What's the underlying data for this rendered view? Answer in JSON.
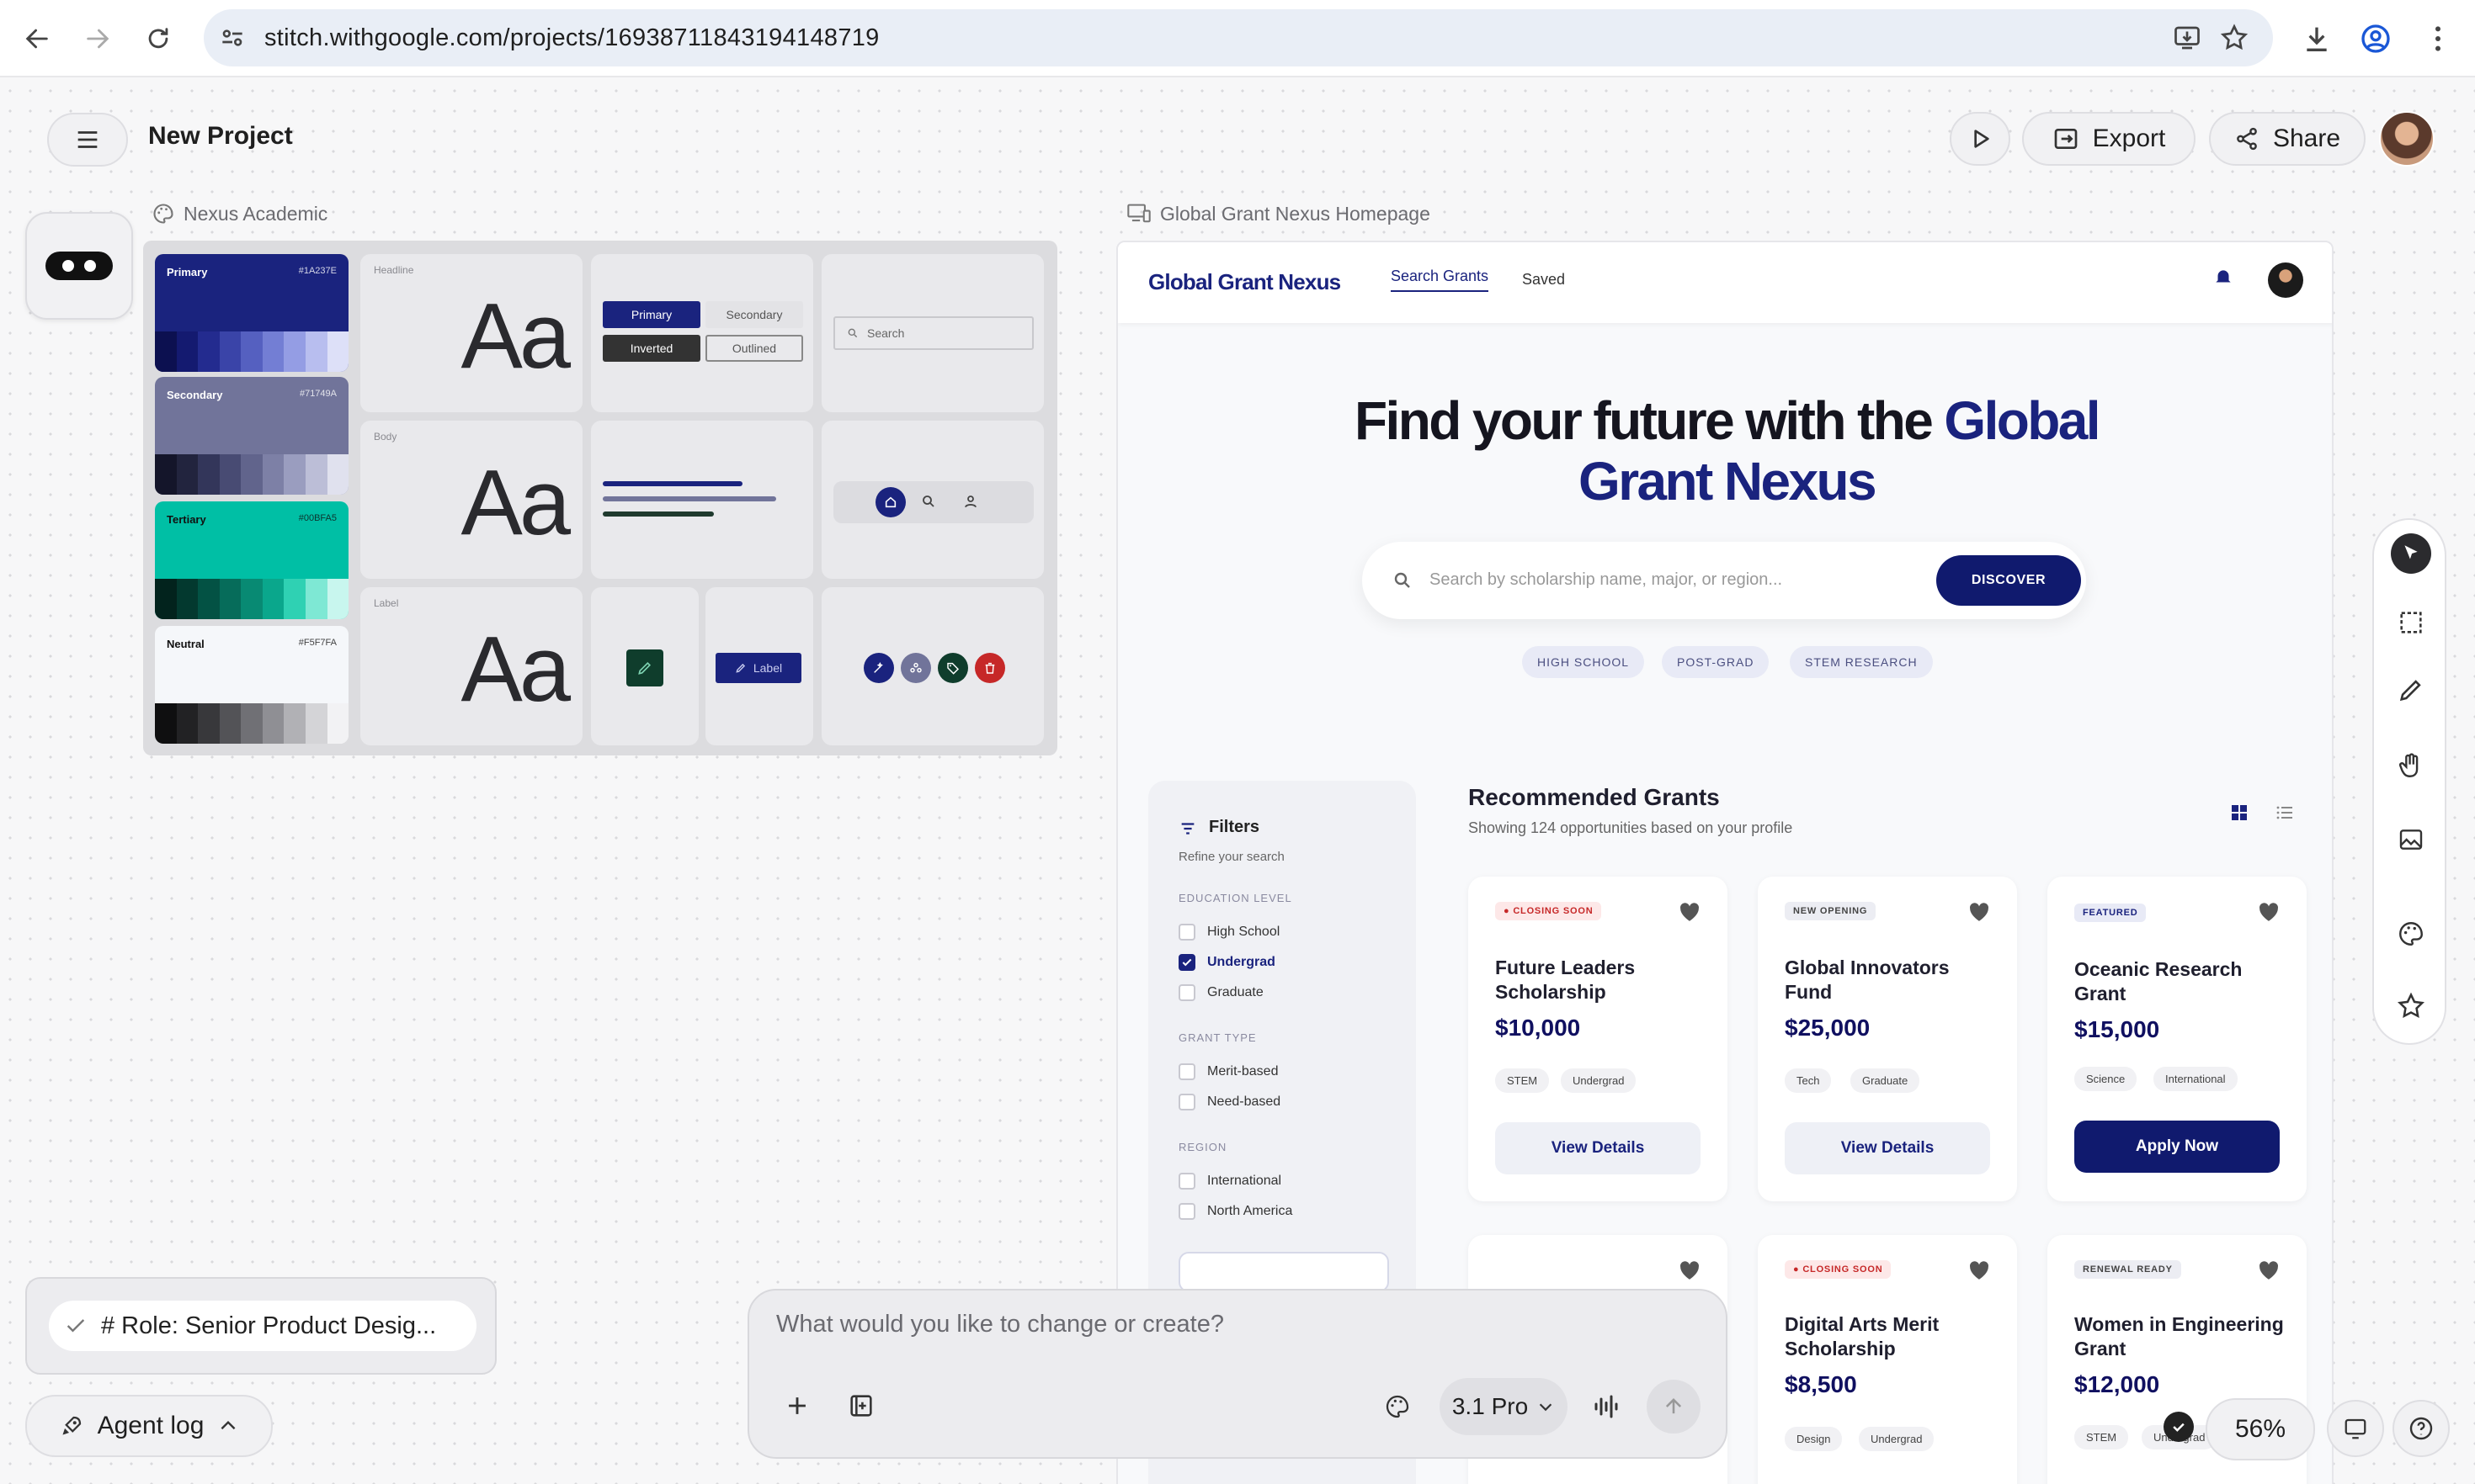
{
  "browser": {
    "url": "stitch.withgoogle.com/projects/16938711843194148719"
  },
  "app": {
    "project_title": "New Project",
    "export_label": "Export",
    "share_label": "Share"
  },
  "design_system": {
    "label": "Nexus Academic",
    "swatches": [
      {
        "name": "Primary",
        "hex": "#1A237E",
        "color": "#1a237e"
      },
      {
        "name": "Secondary",
        "hex": "#71749A",
        "color": "#71749a"
      },
      {
        "name": "Tertiary",
        "hex": "#00BFA5",
        "color": "#00bfa5"
      },
      {
        "name": "Neutral",
        "hex": "#F5F7FA",
        "color": "#f5f7fa"
      }
    ],
    "type_labels": [
      "Headline",
      "Body",
      "Label"
    ],
    "aa": "Aa",
    "buttons": {
      "primary": "Primary",
      "secondary": "Secondary",
      "inverted": "Inverted",
      "outlined": "Outlined"
    },
    "search_placeholder": "Search",
    "chip_label": "Label"
  },
  "preview": {
    "label": "Global Grant Nexus Homepage",
    "brand": "Global Grant Nexus",
    "nav": [
      "Search Grants",
      "Saved"
    ],
    "hero_line1": "Find your future with the",
    "hero_accent1": "Global",
    "hero_line2": "Grant Nexus",
    "search_placeholder": "Search by scholarship name, major, or region...",
    "discover_label": "DISCOVER",
    "quick_tags": [
      "HIGH SCHOOL",
      "POST-GRAD",
      "STEM RESEARCH"
    ],
    "filters": {
      "title": "Filters",
      "subtitle": "Refine your search",
      "education_label": "EDUCATION LEVEL",
      "education": [
        "High School",
        "Undergrad",
        "Graduate"
      ],
      "grant_type_label": "GRANT TYPE",
      "grant_types": [
        "Merit-based",
        "Need-based"
      ],
      "region_label": "REGION",
      "regions": [
        "International",
        "North America"
      ]
    },
    "recommended_title": "Recommended Grants",
    "recommended_subtitle": "Showing 124 opportunities based on your profile",
    "cards": [
      {
        "badge": "CLOSING SOON",
        "title": "Future Leaders Scholarship",
        "amount": "$10,000",
        "tags": [
          "STEM",
          "Undergrad"
        ],
        "button": "View Details"
      },
      {
        "badge": "NEW OPENING",
        "title": "Global Innovators Fund",
        "amount": "$25,000",
        "tags": [
          "Tech",
          "Graduate"
        ],
        "button": "View Details"
      },
      {
        "badge": "FEATURED",
        "title": "Oceanic Research Grant",
        "amount": "$15,000",
        "tags": [
          "Science",
          "International"
        ],
        "button": "Apply Now"
      },
      {
        "badge": "CLOSING SOON",
        "title": "Digital Arts Merit Scholarship",
        "amount": "$8,500",
        "tags": [
          "Design",
          "Undergrad"
        ]
      },
      {
        "badge": "RENEWAL READY",
        "title": "Women in Engineering Grant",
        "amount": "$12,000",
        "tags": [
          "STEM",
          "Undergrad"
        ]
      }
    ]
  },
  "bottom": {
    "prompt_chip": "# Role: Senior Product Desig...",
    "agent_log": "Agent log",
    "chat_placeholder": "What would you like to change or create?",
    "model": "3.1 Pro",
    "zoom": "56%"
  }
}
